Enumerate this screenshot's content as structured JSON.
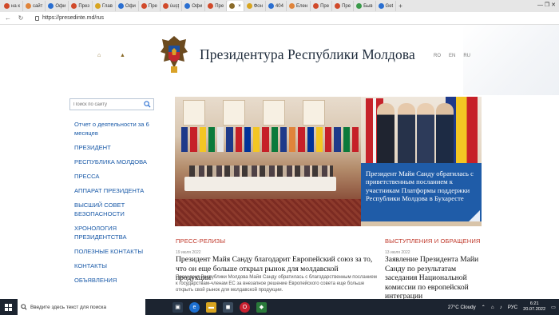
{
  "browser": {
    "tabs": [
      {
        "label": "на к",
        "color": "#d14a2a",
        "active": false
      },
      {
        "label": "сайт",
        "color": "#e0843a",
        "active": false
      },
      {
        "label": "Офи",
        "color": "#2a6fd1",
        "active": false
      },
      {
        "label": "През",
        "color": "#d14a2a",
        "active": false
      },
      {
        "label": "Глав",
        "color": "#d8a520",
        "active": false
      },
      {
        "label": "Офи",
        "color": "#2a6fd1",
        "active": false
      },
      {
        "label": "Пре",
        "color": "#d14a2a",
        "active": false
      },
      {
        "label": "ùușț",
        "color": "#d14a2a",
        "active": false
      },
      {
        "label": "Офи",
        "color": "#2a6fd1",
        "active": false
      },
      {
        "label": "Пре",
        "color": "#d14a2a",
        "active": false
      },
      {
        "label": "",
        "color": "#8a6b2a",
        "active": true
      },
      {
        "label": "Фон",
        "color": "#d8a520",
        "active": false
      },
      {
        "label": "404",
        "color": "#2a6fd1",
        "active": false
      },
      {
        "label": "Елен",
        "color": "#e0843a",
        "active": false
      },
      {
        "label": "Пре",
        "color": "#d14a2a",
        "active": false
      },
      {
        "label": "Пре",
        "color": "#d14a2a",
        "active": false
      },
      {
        "label": "Быв",
        "color": "#3a9a4a",
        "active": false
      },
      {
        "label": "Get",
        "color": "#2a6fd1",
        "active": false
      }
    ],
    "new_tab": "+",
    "url": "https://presedinte.md/rus",
    "window_controls": "— ❐ ✕"
  },
  "header": {
    "title": "Президентура Республики Молдова",
    "languages": [
      "RO",
      "EN",
      "RU"
    ]
  },
  "sidebar": {
    "search_placeholder": "Поиск по сайту",
    "items": [
      "Отчет о деятельности за 6 месяцев",
      "ПРЕЗИДЕНТ",
      "РЕСПУБЛИКА МОЛДОВА",
      "ПРЕССА",
      "АППАРАТ ПРЕЗИДЕНТА",
      "ВЫСШИЙ СОВЕТ БЕЗОПАСНОСТИ",
      "ХРОНОЛОГИЯ ПРЕЗИДЕНТСТВА",
      "ПОЛЕЗНЫЕ КОНТАКТЫ",
      "КОНТАКТЫ",
      "ОБЪЯВЛЕНИЯ"
    ]
  },
  "hero": {
    "caption": "Президент Майя Санду обратилась с приветственным посланием к участникам Платформы поддержки Республики Молдова в Бухаресте"
  },
  "press": {
    "title": "ПРЕСС-РЕЛИЗЫ",
    "date": "19 июля 2022",
    "headline": "Президент Майя Санду благодарит Европейский союз за то, что он еще больше открыл рынок для молдавской продукции",
    "text": "Президент Республики Молдова Майя Санду обратилась с благодарственным посланием к государствам-членам ЕС за внезапное решение Европейского совета еще больше открыть свой рынок для молдавской продукции."
  },
  "speeches": {
    "title": "ВЫСТУПЛЕНИЯ И ОБРАЩЕНИЯ",
    "date": "13 июля 2022",
    "headline": "Заявление Президента Майи Санду по результатам заседания Национальной комиссии по европейской интеграции"
  },
  "taskbar": {
    "search_text": "Введите здесь текст для поиска",
    "weather": "27°C  Cloudy",
    "lang": "РУС",
    "time": "6:21",
    "date": "20.07.2022"
  },
  "colors": {
    "accent_blue": "#1f5ca8",
    "link_blue": "#1a5aa8",
    "section_red": "#c0392b"
  }
}
